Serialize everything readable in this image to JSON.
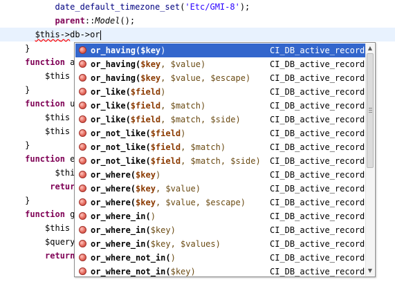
{
  "code": {
    "line1": {
      "call": "date_default_timezone_set",
      "open": "(",
      "arg": "'Etc/GMI-8'",
      "close": ");"
    },
    "line2": {
      "kw": "parent",
      "sep": "::",
      "cls": "Model",
      "tail": "();"
    },
    "line3": {
      "var": "$this",
      "arrow": "->",
      "prop": "db",
      "arrow2": "->",
      "typed": "or"
    },
    "brace_close": "}",
    "fn_kw": "function",
    "partials": {
      "l5": "a",
      "l6": "$this",
      "l8": "u",
      "l9": "$this",
      "l10": "$this",
      "l12": "e",
      "l13": "$thi",
      "l14": "retur",
      "l16": "g",
      "l17": "$this",
      "l18": "$query",
      "l19": "return"
    }
  },
  "popup": {
    "class_name": "CI_DB_active_record",
    "items": [
      {
        "name": "or_having",
        "open": "(",
        "p1": "$key",
        "rest": "",
        "close": ")",
        "selected": true
      },
      {
        "name": "or_having",
        "open": "(",
        "p1": "$key",
        "rest": ", $value",
        "close": ")"
      },
      {
        "name": "or_having",
        "open": "(",
        "p1": "$key",
        "rest": ", $value, $escape",
        "close": ")"
      },
      {
        "name": "or_like",
        "open": "(",
        "p1": "$field",
        "rest": "",
        "close": ")"
      },
      {
        "name": "or_like",
        "open": "(",
        "p1": "$field",
        "rest": ", $match",
        "close": ")"
      },
      {
        "name": "or_like",
        "open": "(",
        "p1": "$field",
        "rest": ", $match, $side",
        "close": ")"
      },
      {
        "name": "or_not_like",
        "open": "(",
        "p1": "$field",
        "rest": "",
        "close": ")"
      },
      {
        "name": "or_not_like",
        "open": "(",
        "p1": "$field",
        "rest": ", $match",
        "close": ")"
      },
      {
        "name": "or_not_like",
        "open": "(",
        "p1": "$field",
        "rest": ", $match, $side",
        "close": ")"
      },
      {
        "name": "or_where",
        "open": "(",
        "p1": "$key",
        "rest": "",
        "close": ")"
      },
      {
        "name": "or_where",
        "open": "(",
        "p1": "$key",
        "rest": ", $value",
        "close": ")"
      },
      {
        "name": "or_where",
        "open": "(",
        "p1": "$key",
        "rest": ", $value, $escape",
        "close": ")"
      },
      {
        "name": "or_where_in",
        "open": "(",
        "p1": "",
        "rest": "",
        "close": ")"
      },
      {
        "name": "or_where_in",
        "open": "(",
        "p1": "",
        "rest": "$key",
        "close": ")"
      },
      {
        "name": "or_where_in",
        "open": "(",
        "p1": "",
        "rest": "$key, $values",
        "close": ")"
      },
      {
        "name": "or_where_not_in",
        "open": "(",
        "p1": "",
        "rest": "",
        "close": ")"
      },
      {
        "name": "or_where_not_in",
        "open": "(",
        "p1": "",
        "rest": "$key",
        "close": ")"
      }
    ],
    "scroll_up_icon": "triangle-up",
    "scroll_down_icon": "triangle-down"
  }
}
